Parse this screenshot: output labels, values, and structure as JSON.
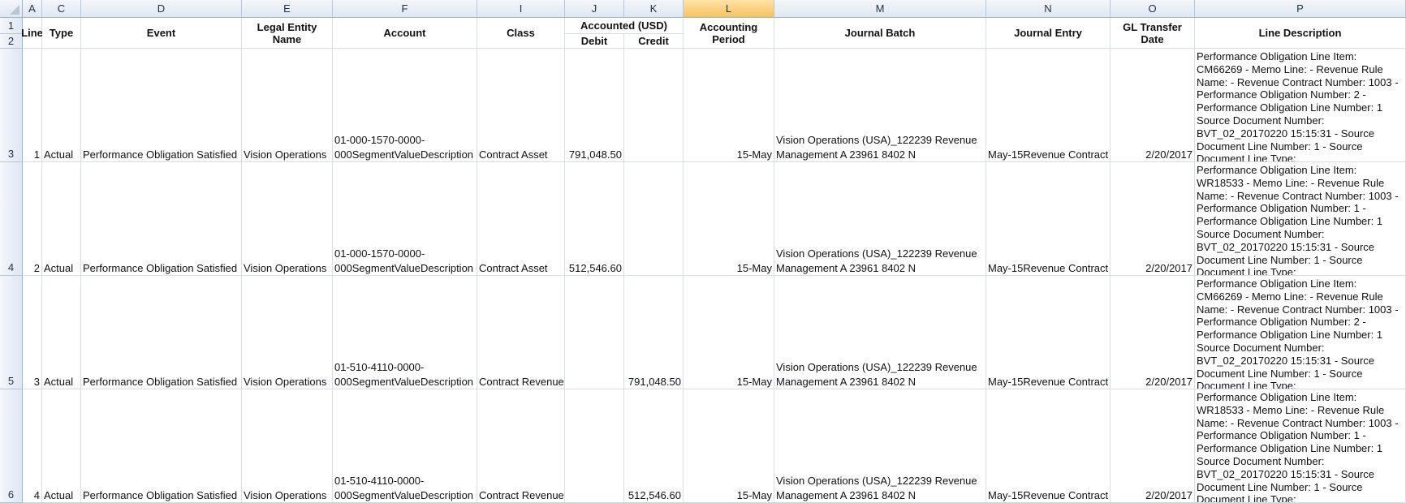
{
  "columns": [
    {
      "letter": "A",
      "selected": false
    },
    {
      "letter": "C",
      "selected": false
    },
    {
      "letter": "D",
      "selected": false
    },
    {
      "letter": "E",
      "selected": false
    },
    {
      "letter": "F",
      "selected": false
    },
    {
      "letter": "I",
      "selected": false
    },
    {
      "letter": "J",
      "selected": false
    },
    {
      "letter": "K",
      "selected": false
    },
    {
      "letter": "L",
      "selected": true
    },
    {
      "letter": "M",
      "selected": false
    },
    {
      "letter": "N",
      "selected": false
    },
    {
      "letter": "O",
      "selected": false
    },
    {
      "letter": "P",
      "selected": false
    }
  ],
  "row_numbers": [
    "1",
    "2",
    "3",
    "4",
    "5",
    "6"
  ],
  "headers": {
    "line": "Line",
    "type": "Type",
    "event": "Event",
    "legal_entity": "Legal Entity Name",
    "account": "Account",
    "class": "Class",
    "accounted_group": "Accounted (USD)",
    "debit": "Debit",
    "credit": "Credit",
    "accounting_period": "Accounting Period",
    "journal_batch": "Journal Batch",
    "journal_entry": "Journal Entry",
    "gl_transfer_date": "GL Transfer Date",
    "line_description": "Line Description"
  },
  "rows": [
    {
      "line": "1",
      "type": "Actual",
      "event": "Performance Obligation Satisfied",
      "legal_entity": "Vision Operations",
      "account_1": "01-000-1570-0000-",
      "account_2": "000SegmentValueDescription",
      "class": "Contract Asset",
      "debit": "791,048.50",
      "credit": "",
      "period": "15-May",
      "batch_1": "Vision Operations (USA)_122239 Revenue",
      "batch_2": "Management A 23961 8402 N",
      "entry": "May-15Revenue Contract",
      "gl_date": "2/20/2017",
      "desc": "Performance Obligation Line Item: CM66269 - Memo Line: - Revenue Rule Name: - Revenue Contract Number: 1003 - Performance Obligation Number: 2 - Performance Obligation Line Number: 1 Source Document Number: BVT_02_20170220 15:15:31 - Source Document Line Number: 1 - Source Document Line Type:"
    },
    {
      "line": "2",
      "type": "Actual",
      "event": "Performance Obligation Satisfied",
      "legal_entity": "Vision Operations",
      "account_1": "01-000-1570-0000-",
      "account_2": "000SegmentValueDescription",
      "class": "Contract Asset",
      "debit": "512,546.60",
      "credit": "",
      "period": "15-May",
      "batch_1": "Vision Operations (USA)_122239 Revenue",
      "batch_2": "Management A 23961 8402 N",
      "entry": "May-15Revenue Contract",
      "gl_date": "2/20/2017",
      "desc": "Performance Obligation Line Item: WR18533 - Memo Line: - Revenue Rule Name: - Revenue Contract Number: 1003 - Performance Obligation Number: 1 - Performance Obligation Line Number: 1 Source Document Number: BVT_02_20170220 15:15:31 - Source Document Line Number: 1 - Source Document Line Type:"
    },
    {
      "line": "3",
      "type": "Actual",
      "event": "Performance Obligation Satisfied",
      "legal_entity": "Vision Operations",
      "account_1": "01-510-4110-0000-",
      "account_2": "000SegmentValueDescription",
      "class": "Contract Revenue",
      "debit": "",
      "credit": "791,048.50",
      "period": "15-May",
      "batch_1": "Vision Operations (USA)_122239 Revenue",
      "batch_2": "Management A 23961 8402 N",
      "entry": "May-15Revenue Contract",
      "gl_date": "2/20/2017",
      "desc": "Performance Obligation Line Item: CM66269 - Memo Line: - Revenue Rule Name: - Revenue Contract Number: 1003 - Performance Obligation Number: 2 - Performance Obligation Line Number: 1 Source Document Number: BVT_02_20170220 15:15:31 - Source Document Line Number: 1 - Source Document Line Type:"
    },
    {
      "line": "4",
      "type": "Actual",
      "event": "Performance Obligation Satisfied",
      "legal_entity": "Vision Operations",
      "account_1": "01-510-4110-0000-",
      "account_2": "000SegmentValueDescription",
      "class": "Contract Revenue",
      "debit": "",
      "credit": "512,546.60",
      "period": "15-May",
      "batch_1": "Vision Operations (USA)_122239 Revenue",
      "batch_2": "Management A 23961 8402 N",
      "entry": "May-15Revenue Contract",
      "gl_date": "2/20/2017",
      "desc": "Performance Obligation Line Item: WR18533 - Memo Line: - Revenue Rule Name: - Revenue Contract Number: 1003 - Performance Obligation Number: 1 - Performance Obligation Line Number: 1 Source Document Number: BVT_02_20170220 15:15:31 - Source Document Line Number: 1 - Source Document Line Type:"
    }
  ]
}
